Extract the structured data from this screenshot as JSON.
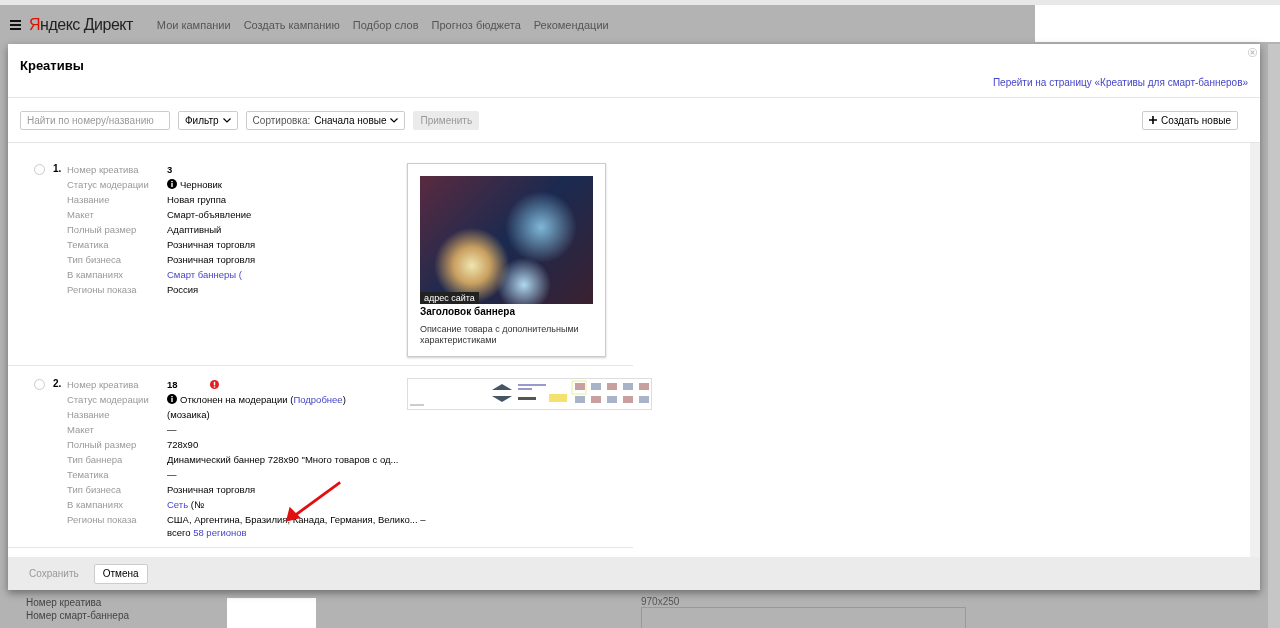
{
  "header": {
    "logo": "Яндекс Директ",
    "nav": [
      "Мои кампании",
      "Создать кампанию",
      "Подбор слов",
      "Прогноз бюджета",
      "Рекомендации"
    ]
  },
  "background": {
    "labels": [
      "Номер креатива",
      "Номер смарт-баннера"
    ],
    "size_label": "970x250"
  },
  "modal": {
    "title": "Креативы",
    "link": "Перейти на страницу «Креативы для смарт-баннеров»",
    "search": {
      "placeholder": "Найти по номеру/названию"
    },
    "filter": "Фильтр",
    "sort": {
      "label": "Сортировка:",
      "value": "Сначала новые"
    },
    "apply": {
      "label": "Применить",
      "disabled": true
    },
    "create": "Создать новые",
    "items": [
      {
        "index": "1.",
        "selected": false,
        "warning": false,
        "fields": [
          {
            "label": "Номер креатива",
            "parts": [
              {
                "text": "3",
                "kind": "bold"
              }
            ]
          },
          {
            "label": "Статус модерации",
            "parts": [
              {
                "text": "Черновик",
                "kind": "status"
              }
            ]
          },
          {
            "label": "Название",
            "parts": [
              {
                "text": "Новая группа",
                "kind": "plain"
              }
            ]
          },
          {
            "label": "Макет",
            "parts": [
              {
                "text": "Смарт-объявление",
                "kind": "plain"
              }
            ]
          },
          {
            "label": "Полный размер",
            "parts": [
              {
                "text": "Адаптивный",
                "kind": "plain"
              }
            ]
          },
          {
            "label": "Тематика",
            "parts": [
              {
                "text": "Розничная торговля",
                "kind": "plain"
              }
            ]
          },
          {
            "label": "Тип бизнеса",
            "parts": [
              {
                "text": "Розничная торговля",
                "kind": "plain"
              }
            ]
          },
          {
            "label": "В кампаниях",
            "parts": [
              {
                "text": "Смарт баннеры (",
                "kind": "link"
              }
            ]
          },
          {
            "label": "Регионы показа",
            "parts": [
              {
                "text": "Россия",
                "kind": "plain"
              }
            ]
          }
        ],
        "preview": {
          "kind": "smart",
          "site_tag": "адрес сайта",
          "title": "Заголовок баннера",
          "description": "Описание товара с дополнительными характеристиками"
        }
      },
      {
        "index": "2.",
        "selected": false,
        "warning": true,
        "fields": [
          {
            "label": "Номер креатива",
            "parts": [
              {
                "text": "18",
                "kind": "bold"
              }
            ]
          },
          {
            "label": "Статус модерации",
            "parts": [
              {
                "text": "Отклонен на модерации (",
                "kind": "status"
              },
              {
                "text": "Подробнее",
                "kind": "link"
              },
              {
                "text": ")",
                "kind": "plain"
              }
            ]
          },
          {
            "label": "Название",
            "parts": [
              {
                "text": "(мозаика)",
                "kind": "plain"
              }
            ]
          },
          {
            "label": "Макет",
            "parts": [
              {
                "text": "—",
                "kind": "plain"
              }
            ]
          },
          {
            "label": "Полный размер",
            "parts": [
              {
                "text": "728x90",
                "kind": "plain"
              }
            ]
          },
          {
            "label": "Тип баннера",
            "parts": [
              {
                "text": "Динамический баннер 728x90 \"Много товаров с од...",
                "kind": "plain"
              }
            ]
          },
          {
            "label": "Тематика",
            "parts": [
              {
                "text": "—",
                "kind": "plain"
              }
            ]
          },
          {
            "label": "Тип бизнеса",
            "parts": [
              {
                "text": "Розничная торговля",
                "kind": "plain"
              }
            ]
          },
          {
            "label": "В кампаниях",
            "parts": [
              {
                "text": "Сеть",
                "kind": "link"
              },
              {
                "text": " (№",
                "kind": "plain"
              }
            ]
          },
          {
            "label": "Регионы показа",
            "parts": [
              {
                "text": "США, Аргентина, Бразилия, Канада, Германия, Велико... – всего ",
                "kind": "plain"
              },
              {
                "text": "58 регионов",
                "kind": "link"
              }
            ]
          }
        ],
        "preview": {
          "kind": "banner"
        }
      }
    ],
    "footer": {
      "save": {
        "label": "Сохранить",
        "disabled": true
      },
      "cancel": "Отмена"
    }
  }
}
